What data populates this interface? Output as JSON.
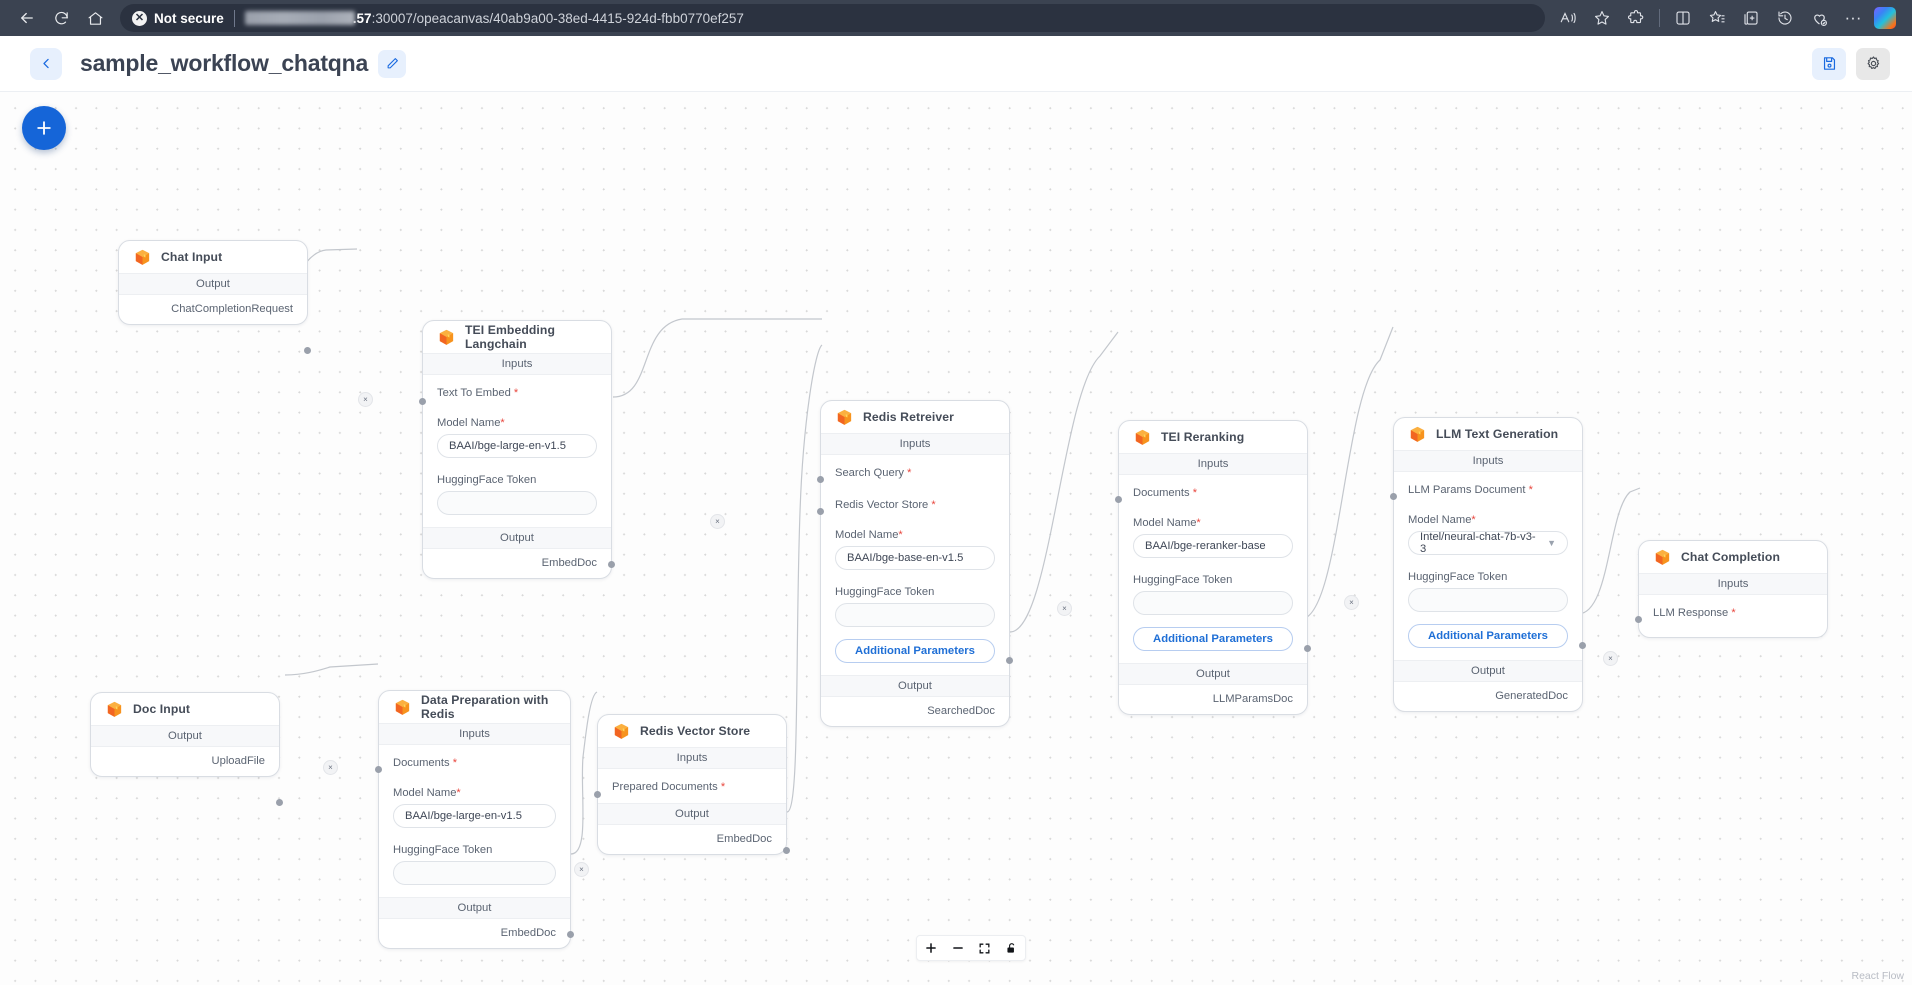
{
  "browser": {
    "back_icon": "arrow-left-icon",
    "refresh_icon": "refresh-icon",
    "home_icon": "home-icon",
    "security_label": "Not secure",
    "security_icon": "not-secure-icon",
    "url_visible_tail": "57:30007/opeacanvas/40ab9a00-38ed-4415-924d-fbb0770ef257",
    "url_host_bold": ".57",
    "actions": [
      {
        "name": "read-aloud-icon",
        "label": "A"
      },
      {
        "name": "favorite-star-icon",
        "label": ""
      },
      {
        "name": "extensions-icon",
        "label": ""
      },
      {
        "name": "split-screen-icon",
        "label": ""
      },
      {
        "name": "favorites-list-icon",
        "label": ""
      },
      {
        "name": "collections-icon",
        "label": ""
      },
      {
        "name": "history-icon",
        "label": ""
      },
      {
        "name": "browser-essentials-icon",
        "label": ""
      },
      {
        "name": "settings-more-icon",
        "label": "···"
      },
      {
        "name": "copilot-icon",
        "label": ""
      }
    ]
  },
  "header": {
    "back_label": "‹",
    "title": "sample_workflow_chatqna",
    "edit_icon": "pencil-icon",
    "save_icon": "save-icon",
    "settings_icon": "gear-icon"
  },
  "canvas": {
    "add_node_label": "+",
    "watermark": "React Flow",
    "controls": [
      {
        "name": "zoom-in-button",
        "label": "+"
      },
      {
        "name": "zoom-out-button",
        "label": "−"
      },
      {
        "name": "fit-view-button",
        "label": "⛶"
      },
      {
        "name": "lock-toggle-button",
        "label": "🔓"
      }
    ],
    "edge_delete_label": "×"
  },
  "labels": {
    "inputs": "Inputs",
    "output": "Output",
    "required_mark": "*",
    "additional_parameters": "Additional Parameters",
    "model_name": "Model Name",
    "huggingface_token": "HuggingFace Token"
  },
  "nodes": {
    "chat_input": {
      "title": "Chat Input",
      "output_section": "Output",
      "output_port": "ChatCompletionRequest"
    },
    "tei_embedding": {
      "title": "TEI Embedding Langchain",
      "inputs_section": "Inputs",
      "input_port": "Text To Embed",
      "model_name_label": "Model Name",
      "model_name_value": "BAAI/bge-large-en-v1.5",
      "token_label": "HuggingFace Token",
      "token_value": "",
      "output_section": "Output",
      "output_port": "EmbedDoc"
    },
    "redis_retriever": {
      "title": "Redis Retreiver",
      "inputs_section": "Inputs",
      "input_port_1": "Search Query",
      "input_port_2": "Redis Vector Store",
      "model_name_label": "Model Name",
      "model_name_value": "BAAI/bge-base-en-v1.5",
      "token_label": "HuggingFace Token",
      "token_value": "",
      "additional_parameters": "Additional Parameters",
      "output_section": "Output",
      "output_port": "SearchedDoc"
    },
    "tei_reranking": {
      "title": "TEI Reranking",
      "inputs_section": "Inputs",
      "input_port": "Documents",
      "model_name_label": "Model Name",
      "model_name_value": "BAAI/bge-reranker-base",
      "token_label": "HuggingFace Token",
      "token_value": "",
      "additional_parameters": "Additional Parameters",
      "output_section": "Output",
      "output_port": "LLMParamsDoc"
    },
    "llm_text_generation": {
      "title": "LLM Text Generation",
      "inputs_section": "Inputs",
      "input_port": "LLM Params Document",
      "model_name_label": "Model Name",
      "model_name_value": "Intel/neural-chat-7b-v3-3",
      "token_label": "HuggingFace Token",
      "token_value": "",
      "additional_parameters": "Additional Parameters",
      "output_section": "Output",
      "output_port": "GeneratedDoc"
    },
    "chat_completion": {
      "title": "Chat Completion",
      "inputs_section": "Inputs",
      "input_port": "LLM Response"
    },
    "doc_input": {
      "title": "Doc Input",
      "output_section": "Output",
      "output_port": "UploadFile"
    },
    "data_preparation": {
      "title": "Data Preparation with Redis",
      "inputs_section": "Inputs",
      "input_port": "Documents",
      "model_name_label": "Model Name",
      "model_name_value": "BAAI/bge-large-en-v1.5",
      "token_label": "HuggingFace Token",
      "token_value": "",
      "output_section": "Output",
      "output_port": "EmbedDoc"
    },
    "redis_vector_store": {
      "title": "Redis Vector Store",
      "inputs_section": "Inputs",
      "input_port": "Prepared Documents",
      "output_section": "Output",
      "output_port": "EmbedDoc"
    }
  }
}
